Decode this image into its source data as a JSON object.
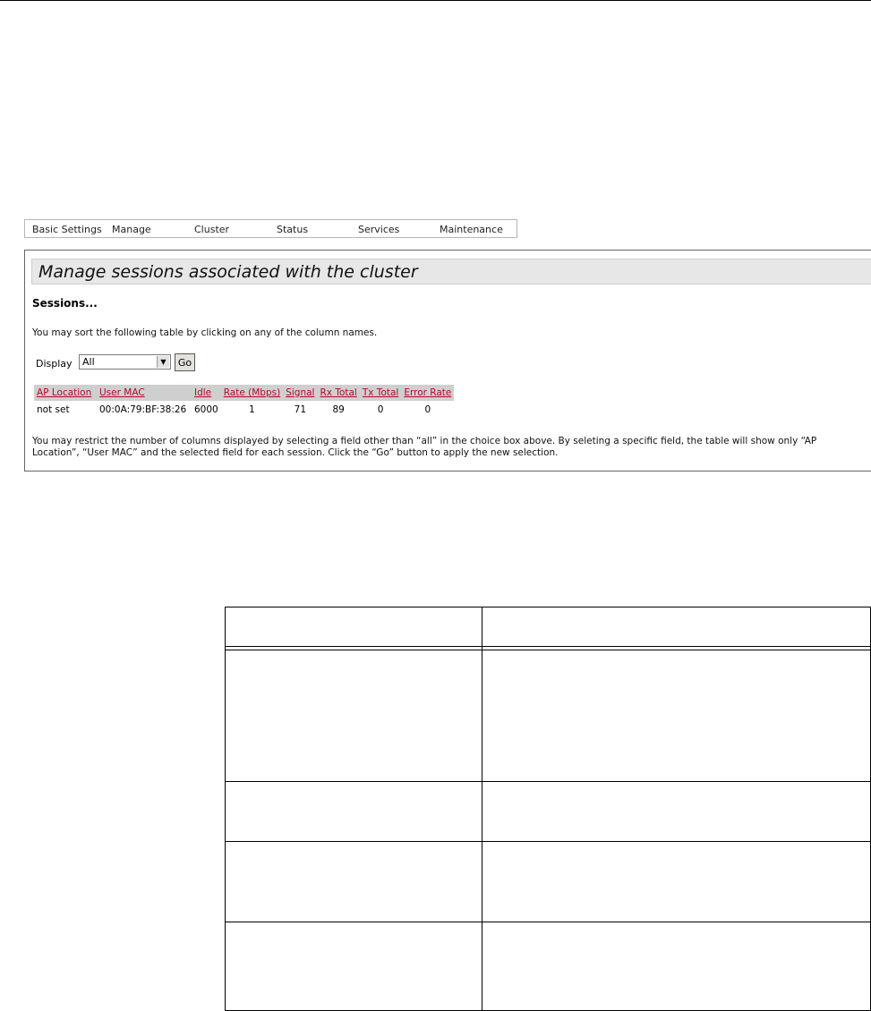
{
  "nav": {
    "items": [
      "Basic Settings",
      "Manage",
      "Cluster",
      "Status",
      "Services",
      "Maintenance"
    ]
  },
  "page": {
    "title": "Manage sessions associated with the cluster",
    "section_heading": "Sessions...",
    "sort_note": "You may sort the following table by clicking on any of the column names.",
    "display_label": "Display",
    "display_value": "All",
    "go_label": "Go",
    "restrict_note": "You may restrict the number of columns displayed by selecting a field other than “all” in the choice box above.   By seleting a specific field, the table will show only “AP Location”, “User MAC” and the selected field for each session.  Click the “Go” button to apply the new selection."
  },
  "sessions_table": {
    "columns": [
      "AP Location",
      "User MAC",
      "Idle",
      "Rate (Mbps)",
      "Signal",
      "Rx Total",
      "Tx Total",
      "Error Rate"
    ],
    "rows": [
      [
        "not set",
        "00:0A:79:BF:38:26",
        "6000",
        "1",
        "71",
        "89",
        "0",
        "0"
      ]
    ]
  },
  "colors": {
    "header_link": "#b00a2c",
    "header_bg": "#cfcfcf",
    "title_bar_bg": "#e7e7e7"
  }
}
